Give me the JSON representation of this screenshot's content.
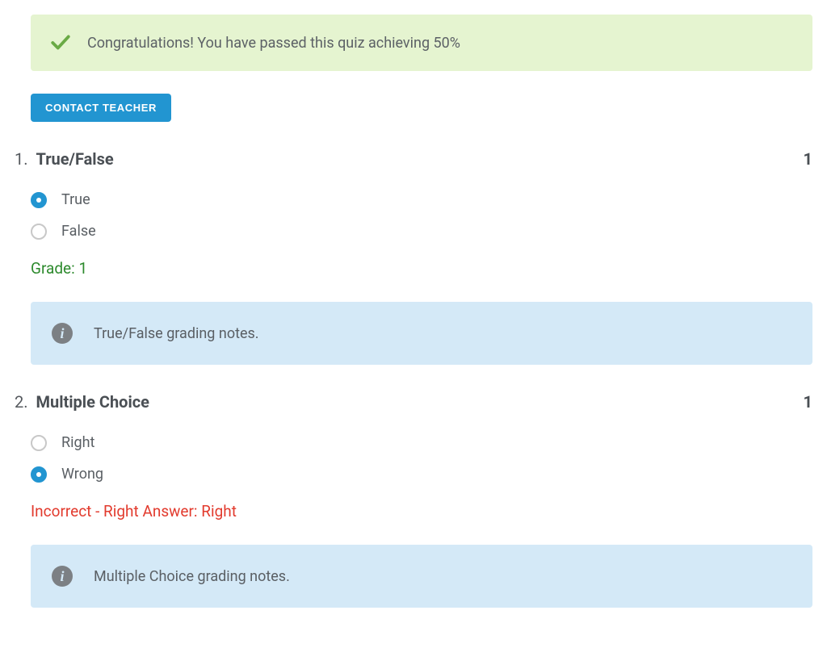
{
  "banner": {
    "message": "Congratulations! You have passed this quiz achieving 50%"
  },
  "contact_button": "Contact Teacher",
  "questions": [
    {
      "number": "1.",
      "title": "True/False",
      "points": "1",
      "options": [
        {
          "label": "True",
          "selected": true
        },
        {
          "label": "False",
          "selected": false
        }
      ],
      "feedback": "Grade: 1",
      "feedback_type": "correct",
      "notes": "True/False grading notes."
    },
    {
      "number": "2.",
      "title": "Multiple Choice",
      "points": "1",
      "options": [
        {
          "label": "Right",
          "selected": false
        },
        {
          "label": "Wrong",
          "selected": true
        }
      ],
      "feedback": "Incorrect - Right Answer: Right",
      "feedback_type": "incorrect",
      "notes": "Multiple Choice grading notes."
    }
  ]
}
